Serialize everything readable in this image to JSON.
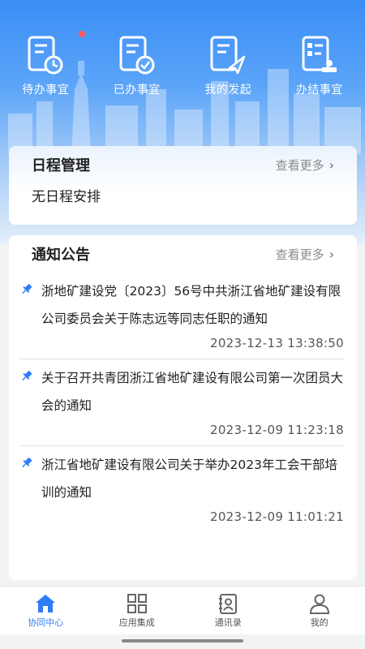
{
  "quick_actions": [
    {
      "label": "待办事宜",
      "icon": "pending-doc-clock-icon",
      "has_badge": true
    },
    {
      "label": "已办事宜",
      "icon": "done-doc-check-icon",
      "has_badge": false
    },
    {
      "label": "我的发起",
      "icon": "initiated-doc-send-icon",
      "has_badge": false
    },
    {
      "label": "办结事宜",
      "icon": "concluded-doc-stamp-icon",
      "has_badge": false
    }
  ],
  "schedule": {
    "title": "日程管理",
    "more_label": "查看更多",
    "empty_text": "无日程安排"
  },
  "notices": {
    "title": "通知公告",
    "more_label": "查看更多",
    "items": [
      {
        "title": "浙地矿建设党〔2023〕56号中共浙江省地矿建设有限公司委员会关于陈志远等同志任职的通知",
        "time": "2023-12-13 13:38:50"
      },
      {
        "title": "关于召开共青团浙江省地矿建设有限公司第一次团员大会的通知",
        "time": "2023-12-09 11:23:18"
      },
      {
        "title": "浙江省地矿建设有限公司关于举办2023年工会干部培训的通知",
        "time": "2023-12-09 11:01:21"
      }
    ]
  },
  "tabs": [
    {
      "label": "协同中心",
      "icon": "home-icon",
      "active": true
    },
    {
      "label": "应用集成",
      "icon": "apps-grid-icon",
      "active": false
    },
    {
      "label": "通讯录",
      "icon": "contacts-icon",
      "active": false
    },
    {
      "label": "我的",
      "icon": "user-icon",
      "active": false
    }
  ],
  "colors": {
    "accent": "#2f7df6",
    "badge": "#ff5a5a",
    "hero_top": "#3a8ef6"
  }
}
